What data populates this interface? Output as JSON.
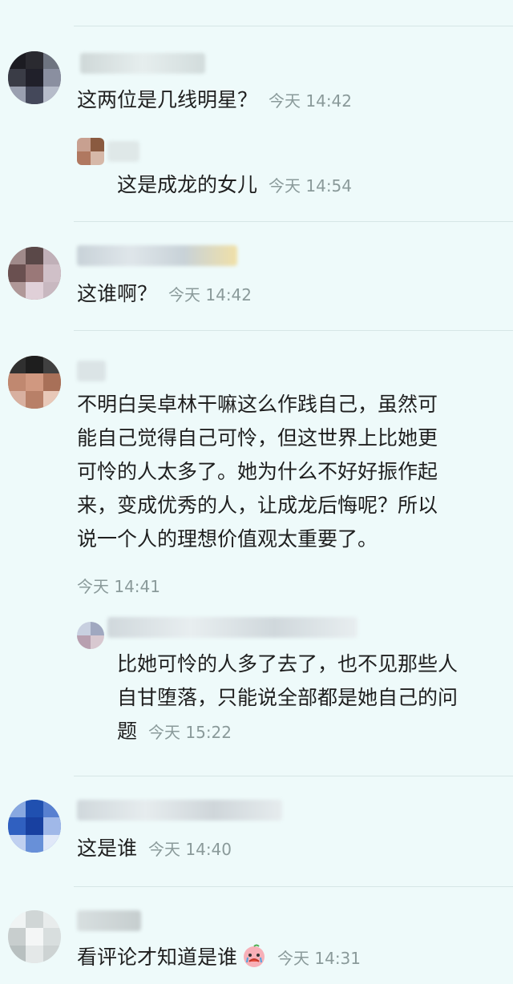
{
  "comments": [
    {
      "text": "这两位是几线明星？",
      "time": "今天 14:42",
      "reply": {
        "text": "这是成龙的女儿",
        "time": "今天 14:54"
      }
    },
    {
      "text": "这谁啊？",
      "time": "今天 14:42"
    },
    {
      "lines": [
        "不明白吴卓林干嘛这么作践自己，虽然可",
        "能自己觉得自己可怜，但这世界上比她更",
        "可怜的人太多了。她为什么不好好振作起",
        "来，变成优秀的人，让成龙后悔呢？所以",
        "说一个人的理想价值观太重要了。"
      ],
      "time": "今天 14:41",
      "reply": {
        "lines": [
          "比她可怜的人多了去了，也不见那些人",
          "自甘堕落，只能说全部都是她自己的问",
          "题"
        ],
        "time": "今天 15:22"
      }
    },
    {
      "text": "这是谁",
      "time": "今天 14:40"
    },
    {
      "text": "看评论才知道是谁",
      "time": "今天 14:31",
      "emoji_icon": "crying-face-emoji"
    }
  ],
  "colors": {
    "background": "#eefafa",
    "text": "#1f1f1f",
    "timestamp": "#8a9a9a",
    "divider": "#d6e6e6"
  }
}
